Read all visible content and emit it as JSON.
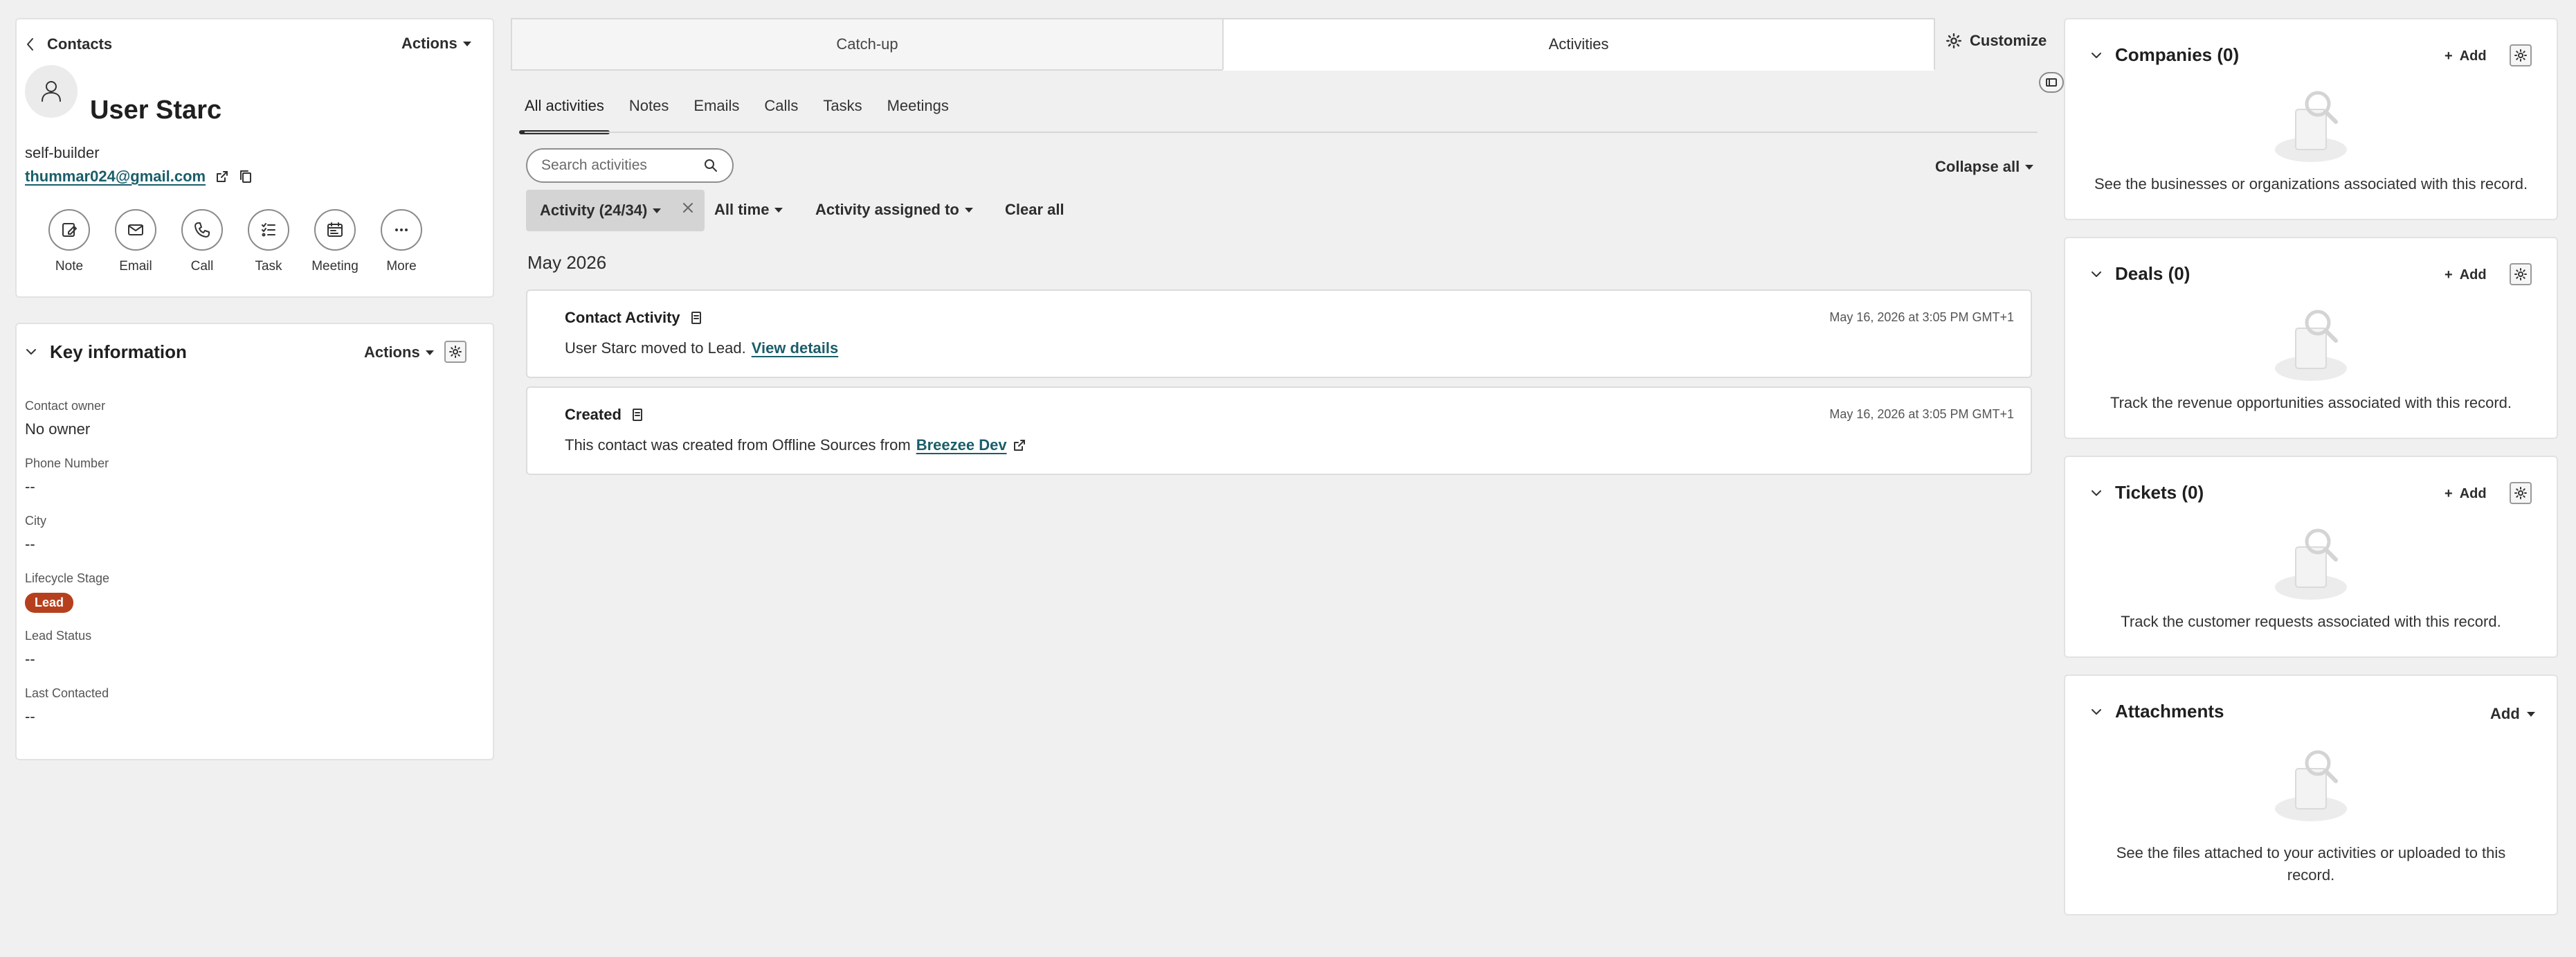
{
  "left": {
    "back_label": "Contacts",
    "actions_label": "Actions",
    "contact": {
      "name": "User Starc",
      "subtitle": "self-builder",
      "email": "thummar024@gmail.com"
    },
    "quick_actions": [
      {
        "label": "Note",
        "icon": "note-icon"
      },
      {
        "label": "Email",
        "icon": "email-icon"
      },
      {
        "label": "Call",
        "icon": "phone-icon"
      },
      {
        "label": "Task",
        "icon": "task-icon"
      },
      {
        "label": "Meeting",
        "icon": "meeting-icon"
      },
      {
        "label": "More",
        "icon": "more-icon"
      }
    ],
    "key_info": {
      "title": "Key information",
      "actions_label": "Actions",
      "properties": [
        {
          "label": "Contact owner",
          "value": "No owner"
        },
        {
          "label": "Phone Number",
          "value": "--"
        },
        {
          "label": "City",
          "value": "--"
        },
        {
          "label": "Lifecycle Stage",
          "value": "Lead"
        },
        {
          "label": "Lead Status",
          "value": "--"
        },
        {
          "label": "Last Contacted",
          "value": "--"
        }
      ]
    }
  },
  "center": {
    "main_tabs": [
      {
        "label": "Catch-up",
        "active": false
      },
      {
        "label": "Activities",
        "active": true
      }
    ],
    "customize_label": "Customize",
    "sub_tabs": [
      "All activities",
      "Notes",
      "Emails",
      "Calls",
      "Tasks",
      "Meetings"
    ],
    "search_placeholder": "Search activities",
    "collapse_all_label": "Collapse all",
    "filters": {
      "activity_chip": "Activity (24/34)",
      "time": "All time",
      "assigned": "Activity assigned to",
      "clear": "Clear all"
    },
    "month": "May 2026",
    "activities": [
      {
        "title": "Contact Activity",
        "timestamp": "May 16, 2026 at 3:05 PM GMT+1",
        "body_text": "User Starc moved to Lead.",
        "link": "View details"
      },
      {
        "title": "Created",
        "timestamp": "May 16, 2026 at 3:05 PM GMT+1",
        "body_text": "This contact was created from Offline Sources from",
        "link": "Breezee Dev"
      }
    ]
  },
  "right": {
    "companies": {
      "title": "Companies (0)",
      "add": "Add",
      "empty": "See the businesses or organizations associated with this record."
    },
    "deals": {
      "title": "Deals (0)",
      "add": "Add",
      "empty": "Track the revenue opportunities associated with this record."
    },
    "tickets": {
      "title": "Tickets (0)",
      "add": "Add",
      "empty": "Track the customer requests associated with this record."
    },
    "attachments": {
      "title": "Attachments",
      "add": "Add",
      "empty_line1": "See the files attached to your activities or uploaded to this",
      "empty_line2": "record."
    }
  },
  "colors": {
    "link": "#1a5e6a",
    "lead_badge": "#b6401d",
    "background": "#f0f0f0"
  }
}
